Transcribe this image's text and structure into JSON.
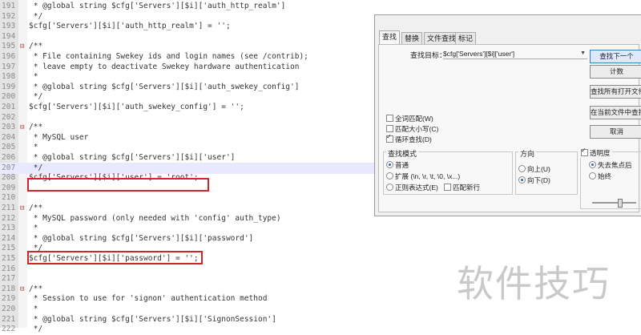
{
  "editor": {
    "lines": [
      {
        "num": "191",
        "fold": "",
        "code": " * @global string $cfg['Servers'][$i]['auth_http_realm']",
        "comment": true
      },
      {
        "num": "192",
        "fold": "",
        "code": " */",
        "comment": true
      },
      {
        "num": "193",
        "fold": "",
        "code": "$cfg['Servers'][$i]['auth_http_realm'] = '';",
        "comment": false
      },
      {
        "num": "194",
        "fold": "",
        "code": "",
        "comment": false
      },
      {
        "num": "195",
        "fold": "⊟",
        "code": "/**",
        "comment": true
      },
      {
        "num": "196",
        "fold": "",
        "code": " * File containing Swekey ids and login names (see /contrib);",
        "comment": true
      },
      {
        "num": "197",
        "fold": "",
        "code": " * leave empty to deactivate Swekey hardware authentication",
        "comment": true
      },
      {
        "num": "198",
        "fold": "",
        "code": " *",
        "comment": true
      },
      {
        "num": "199",
        "fold": "",
        "code": " * @global string $cfg['Servers'][$i]['auth_swekey_config']",
        "comment": true
      },
      {
        "num": "200",
        "fold": "",
        "code": " */",
        "comment": true
      },
      {
        "num": "201",
        "fold": "",
        "code": "$cfg['Servers'][$i]['auth_swekey_config'] = '';",
        "comment": false
      },
      {
        "num": "202",
        "fold": "",
        "code": "",
        "comment": false
      },
      {
        "num": "203",
        "fold": "⊟",
        "code": "/**",
        "comment": true
      },
      {
        "num": "204",
        "fold": "",
        "code": " * MySQL user",
        "comment": true
      },
      {
        "num": "205",
        "fold": "",
        "code": " *",
        "comment": true
      },
      {
        "num": "206",
        "fold": "",
        "code": " * @global string $cfg['Servers'][$i]['user']",
        "comment": true
      },
      {
        "num": "207",
        "fold": "",
        "code": " */",
        "comment": true
      },
      {
        "num": "208",
        "fold": "",
        "code": "$cfg['Servers'][$i]['user'] = 'root';",
        "comment": false
      },
      {
        "num": "209",
        "fold": "",
        "code": "",
        "comment": false
      },
      {
        "num": "210",
        "fold": "",
        "code": "",
        "comment": false
      },
      {
        "num": "211",
        "fold": "⊟",
        "code": "/**",
        "comment": true
      },
      {
        "num": "212",
        "fold": "",
        "code": " * MySQL password (only needed with 'config' auth_type)",
        "comment": true
      },
      {
        "num": "213",
        "fold": "",
        "code": " *",
        "comment": true
      },
      {
        "num": "214",
        "fold": "",
        "code": " * @global string $cfg['Servers'][$i]['password']",
        "comment": true
      },
      {
        "num": "215",
        "fold": "",
        "code": " */",
        "comment": true
      },
      {
        "num": "215",
        "fold": "",
        "code": "$cfg['Servers'][$i]['password'] = '';",
        "comment": false
      },
      {
        "num": "216",
        "fold": "",
        "code": "",
        "comment": false
      },
      {
        "num": "217",
        "fold": "",
        "code": "",
        "comment": false
      },
      {
        "num": "218",
        "fold": "⊟",
        "code": "/**",
        "comment": true
      },
      {
        "num": "219",
        "fold": "",
        "code": " * Session to use for 'signon' authentication method",
        "comment": true
      },
      {
        "num": "220",
        "fold": "",
        "code": " *",
        "comment": true
      },
      {
        "num": "221",
        "fold": "",
        "code": " * @global string $cfg['Servers'][$i]['SignonSession']",
        "comment": true
      },
      {
        "num": "222",
        "fold": "",
        "code": " */",
        "comment": true
      }
    ]
  },
  "watermark": "软件技巧",
  "find_dialog": {
    "tabs": [
      "查找",
      "替换",
      "文件查找",
      "标记"
    ],
    "find_label": "查找目标：",
    "find_value": "$cfg['Servers'][$i]['user']",
    "buttons": [
      "查找下一个",
      "计数",
      "查找所有打开文件",
      "在当前文件中查找",
      "取消"
    ],
    "options": [
      {
        "label": "全词匹配(W)",
        "checked": false
      },
      {
        "label": "匹配大小写(C)",
        "checked": false
      },
      {
        "label": "循环查找(D)",
        "checked": true
      }
    ],
    "mode_title": "查找模式",
    "modes": [
      {
        "label": "普通",
        "selected": true
      },
      {
        "label": "扩展 (\\n, \\r, \\t, \\0, \\x...)",
        "selected": false
      },
      {
        "label": "正则表达式(E)",
        "selected": false
      }
    ],
    "newline_label": "匹配新行",
    "direction_title": "方向",
    "directions": [
      {
        "label": "向上(U)",
        "selected": false
      },
      {
        "label": "向下(D)",
        "selected": true
      }
    ],
    "transparency_label": "透明度",
    "transparency_checked": true,
    "transparency_opts": [
      {
        "label": "失去焦点后",
        "selected": true
      },
      {
        "label": "始终",
        "selected": false
      }
    ]
  }
}
